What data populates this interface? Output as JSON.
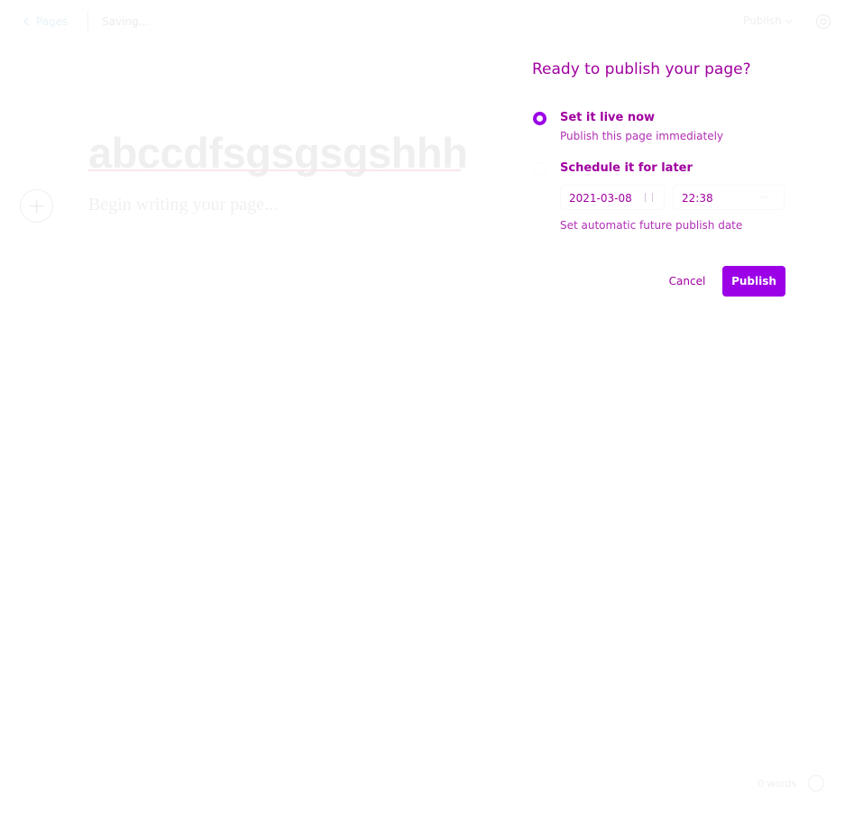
{
  "topbar": {
    "back_label": "Pages",
    "status": "Saving...",
    "publish_label": "Publish",
    "icons": {
      "back": "chevron-left-icon",
      "dropdown": "chevron-down-icon",
      "settings": "gear-icon"
    }
  },
  "editor": {
    "title": "abccdfsgsgsgshhh",
    "body_placeholder": "Begin writing your page...",
    "add_card_icon": "plus-icon"
  },
  "publish_menu": {
    "heading": "Ready to publish your page?",
    "options": [
      {
        "title": "Set it live now",
        "description": "Publish this page immediately",
        "selected": true
      },
      {
        "title": "Schedule it for later",
        "description": "Set automatic future publish date",
        "selected": false
      }
    ],
    "date_value": "2021-03-08",
    "time_value": "22:38",
    "cancel_label": "Cancel",
    "publish_label": "Publish"
  },
  "footer": {
    "word_count": "0 words",
    "help_icon": "question-icon"
  },
  "colors": {
    "accent": "#9b00e6",
    "text_accent": "#a0009f"
  }
}
